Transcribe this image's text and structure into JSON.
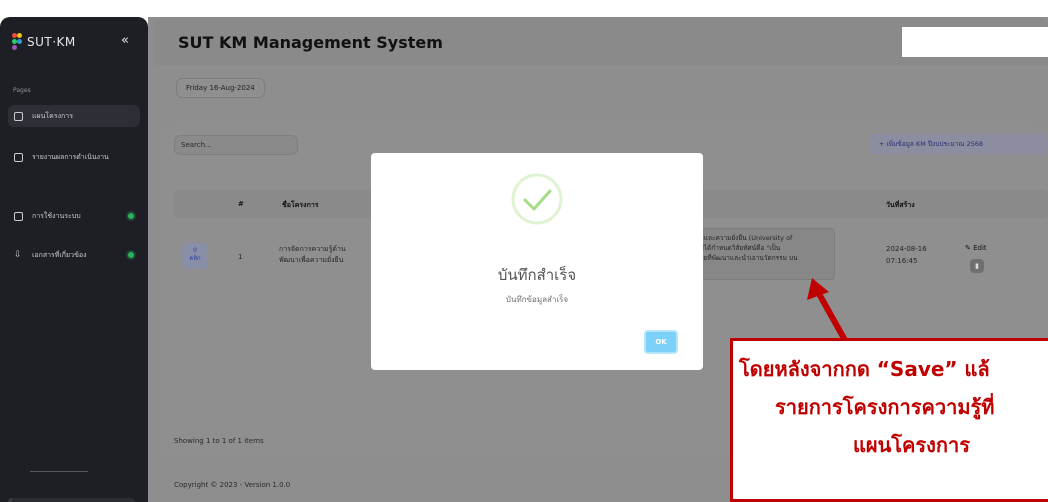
{
  "sidebar": {
    "logo_text": "SUT·KM",
    "collapse_icon": "«",
    "section_label": "Pages",
    "items": [
      {
        "label": "แผนโครงการ",
        "icon": "layout-icon"
      },
      {
        "label": "รายงานผลการดำเนินงาน",
        "icon": "report-icon"
      },
      {
        "label": "การใช้งานระบบ",
        "icon": "manual-icon"
      },
      {
        "label": "เอกสารที่เกี่ยวข้อง",
        "icon": "download-icon"
      }
    ]
  },
  "header": {
    "title": "SUT KM Management System"
  },
  "date_chip": "Friday 16-Aug-2024",
  "toolbar": {
    "search_placeholder": "Search...",
    "add_button": "+  เพิ่มข้อมูล KM ปีงบประมาณ 2568"
  },
  "table": {
    "headers": {
      "index": "#",
      "project": "ชื่อโครงการ",
      "created": "วันที่สร้าง"
    },
    "rows": [
      {
        "view_label": "คลิก",
        "index": "1",
        "project_line1": "การจัดการความรู้ด้าน",
        "project_line2": "พัฒนาเพื่อความยั่งยืน",
        "desc_line1": "รมและความยั่งยืน (University of",
        "desc_line2": "ลัยได้กำหนดวิสัยทัศน์คือ \"เป็น",
        "desc_line3": "ไทยที่พัฒนาและนำเอานวัตกรรม บน",
        "created_date": "2024-08-16",
        "created_time": "07:16:45",
        "edit_label": "Edit"
      }
    ]
  },
  "showing_text": "Showing 1 to 1 of 1 items",
  "footer_text": "Copyright © 2023 - Version 1.0.0",
  "modal": {
    "title": "บันทึกสำเร็จ",
    "subtitle": "บันทึกข้อมูลสำเร็จ",
    "ok_label": "OK"
  },
  "annotation": {
    "line1": "โดยหลังจากกด “Save” แล้",
    "line2": "รายการโครงการความรู้ที่",
    "line3": "แผนโครงการ"
  },
  "colors": {
    "sidebar_bg": "#1d1f24",
    "overlay_gray": "#8e8e8e",
    "success_green": "#a5dc86",
    "ok_blue": "#7cd1f9",
    "annotation_red": "#c00000"
  }
}
